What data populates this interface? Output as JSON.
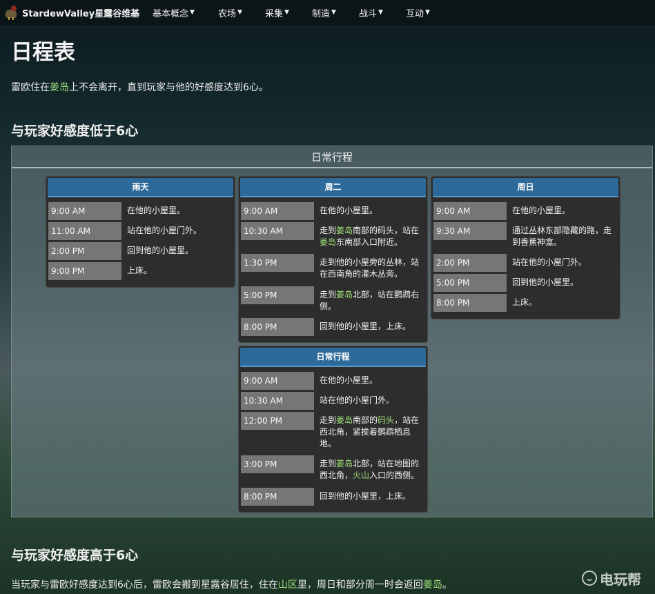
{
  "nav": {
    "brand": "StardewValley星露谷维基",
    "items": [
      "基本概念",
      "农场",
      "采集",
      "制造",
      "战斗",
      "互动"
    ]
  },
  "page": {
    "title": "日程表",
    "intro": {
      "a": "雷欧住在",
      "b": "姜岛",
      "c": "上不会离开，直到玩家与他的好感度达到6心。"
    },
    "section1": "与玩家好感度低于6心",
    "section2": "与玩家好感度高于6心",
    "outro": {
      "a": "当玩家与雷欧好感度达到6心后，雷欧会搬到星露谷居住，住在",
      "b": "山区",
      "c": "里，周日和部分周一时会返回",
      "d": "姜岛",
      "e": "。"
    }
  },
  "schedule": {
    "header": "日常行程",
    "rainy": {
      "title": "雨天",
      "rows": [
        {
          "time": "9:00 AM",
          "desc": "在他的小屋里。"
        },
        {
          "time": "11:00 AM",
          "desc": "站在他的小屋门外。"
        },
        {
          "time": "2:00 PM",
          "desc": "回到他的小屋里。"
        },
        {
          "time": "9:00 PM",
          "desc": "上床。"
        }
      ]
    },
    "tuesday": {
      "title": "周二",
      "rows": [
        {
          "time": "9:00 AM",
          "desc": "在他的小屋里。"
        },
        {
          "time": "10:30 AM",
          "d1": "走到",
          "g1": "姜岛",
          "d2": "南部的码头，站在",
          "g2": "姜岛",
          "d3": "东南部入口附近。"
        },
        {
          "time": "1:30 PM",
          "desc": "走到他的小屋旁的丛林，站在西南角的灌木丛旁。"
        },
        {
          "time": "5:00 PM",
          "d1": "走到",
          "g1": "姜岛",
          "d2": "北部，站在鹦鹉右侧。"
        },
        {
          "time": "8:00 PM",
          "desc": "回到他的小屋里，上床。"
        }
      ]
    },
    "sunday": {
      "title": "周日",
      "rows": [
        {
          "time": "9:00 AM",
          "desc": "在他的小屋里。"
        },
        {
          "time": "9:30 AM",
          "desc": "通过丛林东部隐藏的路，走到香蕉神龛。"
        },
        {
          "time": "2:00 PM",
          "desc": "站在他的小屋门外。"
        },
        {
          "time": "5:00 PM",
          "desc": "回到他的小屋里。"
        },
        {
          "time": "8:00 PM",
          "desc": "上床。"
        }
      ]
    },
    "regular": {
      "title": "日常行程",
      "rows": [
        {
          "time": "9:00 AM",
          "desc": "在他的小屋里。"
        },
        {
          "time": "10:30 AM",
          "desc": "站在他的小屋门外。"
        },
        {
          "time": "12:00 PM",
          "d1": "走到",
          "g1": "姜岛",
          "d2": "南部的",
          "g2": "码头",
          "d3": "，站在西北角，紧挨着鹦鹉栖息地。"
        },
        {
          "time": "3:00 PM",
          "d1": "走到",
          "g1": "姜岛",
          "d2": "北部，站在地图的西北角，",
          "g2": "火山",
          "d3": "入口的西侧。"
        },
        {
          "time": "8:00 PM",
          "desc": "回到他的小屋里，上床。"
        }
      ]
    }
  },
  "watermark": "电玩帮",
  "colors": {
    "link_green": "#9fe07a",
    "card_header_blue": "#2e6a99",
    "time_cell": "#767676"
  }
}
